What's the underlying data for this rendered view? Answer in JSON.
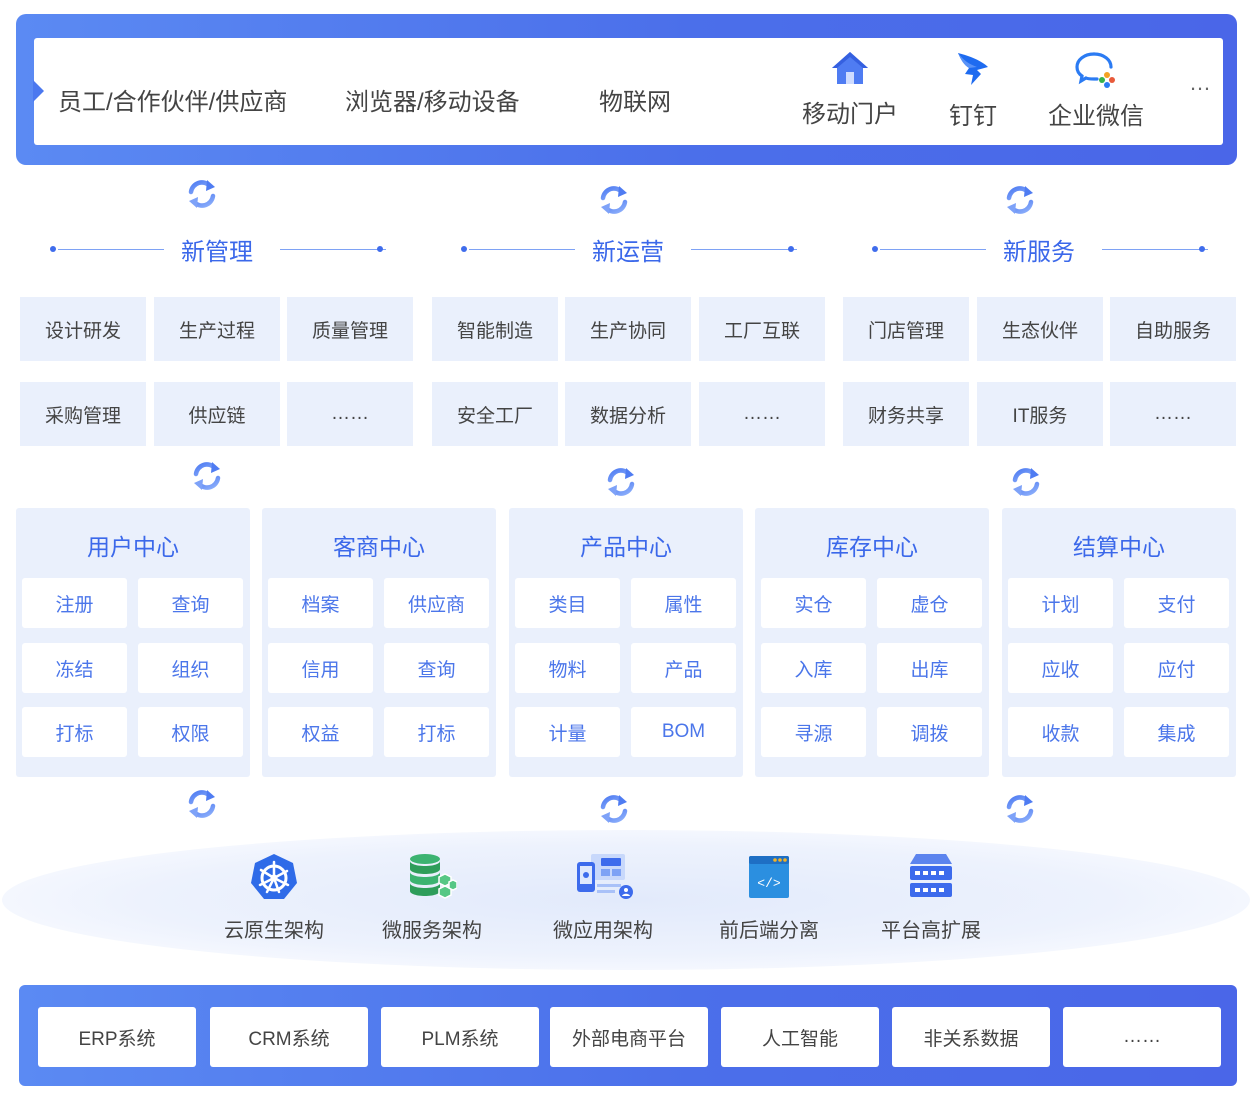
{
  "access": {
    "channels": [
      "员工/合作伙伴/供应商",
      "浏览器/移动设备",
      "物联网"
    ],
    "apps": [
      {
        "label": "移动门户",
        "icon": "home-icon"
      },
      {
        "label": "钉钉",
        "icon": "dingtalk-icon"
      },
      {
        "label": "企业微信",
        "icon": "wecom-icon"
      }
    ],
    "more": "…"
  },
  "sections": [
    {
      "title": "新管理",
      "items": [
        "设计研发",
        "生产过程",
        "质量管理",
        "采购管理",
        "供应链",
        "……"
      ]
    },
    {
      "title": "新运营",
      "items": [
        "智能制造",
        "生产协同",
        "工厂互联",
        "安全工厂",
        "数据分析",
        "……"
      ]
    },
    {
      "title": "新服务",
      "items": [
        "门店管理",
        "生态伙伴",
        "自助服务",
        "财务共享",
        "IT服务",
        "……"
      ]
    }
  ],
  "centers": [
    {
      "title": "用户中心",
      "items": [
        "注册",
        "查询",
        "冻结",
        "组织",
        "打标",
        "权限"
      ]
    },
    {
      "title": "客商中心",
      "items": [
        "档案",
        "供应商",
        "信用",
        "查询",
        "权益",
        "打标"
      ]
    },
    {
      "title": "产品中心",
      "items": [
        "类目",
        "属性",
        "物料",
        "产品",
        "计量",
        "BOM"
      ]
    },
    {
      "title": "库存中心",
      "items": [
        "实仓",
        "虚仓",
        "入库",
        "出库",
        "寻源",
        "调拨"
      ]
    },
    {
      "title": "结算中心",
      "items": [
        "计划",
        "支付",
        "应收",
        "应付",
        "收款",
        "集成"
      ]
    }
  ],
  "architecture": [
    {
      "label": "云原生架构",
      "icon": "kubernetes-icon"
    },
    {
      "label": "微服务架构",
      "icon": "database-cluster-icon"
    },
    {
      "label": "微应用架构",
      "icon": "micro-app-icon"
    },
    {
      "label": "前后端分离",
      "icon": "code-window-icon"
    },
    {
      "label": "平台高扩展",
      "icon": "server-stack-icon"
    }
  ],
  "systems": [
    "ERP系统",
    "CRM系统",
    "PLM系统",
    "外部电商平台",
    "人工智能",
    "非关系数据",
    "……"
  ],
  "colors": {
    "primary": "#4b6fea",
    "accent": "#3b68ea",
    "cell_bg": "#eaf0fc",
    "chip_text": "#4b76ea",
    "green": "#3cb371"
  }
}
